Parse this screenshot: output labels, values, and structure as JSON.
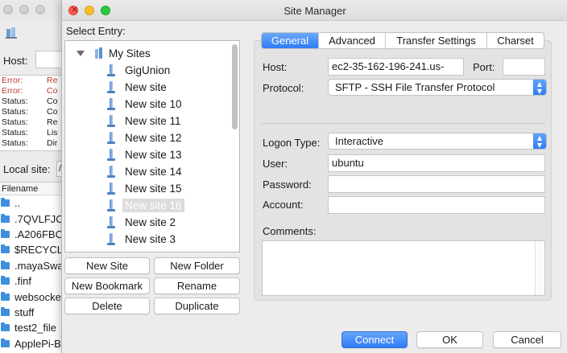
{
  "background_window": {
    "host_label": "Host:",
    "log": [
      {
        "kind": "Error:",
        "text": "Re",
        "is_error": true
      },
      {
        "kind": "Error:",
        "text": "Co",
        "is_error": true
      },
      {
        "kind": "Status:",
        "text": "Co",
        "is_error": false
      },
      {
        "kind": "Status:",
        "text": "Co",
        "is_error": false
      },
      {
        "kind": "Status:",
        "text": "Re",
        "is_error": false
      },
      {
        "kind": "Status:",
        "text": "Lis",
        "is_error": false
      },
      {
        "kind": "Status:",
        "text": "Dir",
        "is_error": false
      }
    ],
    "local_site_label": "Local site:",
    "local_site_value": "/",
    "filename_header": "Filename",
    "files": [
      "..",
      ".7QVLFJC",
      ".A206FBC",
      "$RECYCL",
      ".mayaSwa",
      ".finf",
      "websocke",
      "stuff",
      "test2_file",
      "ApplePi-B"
    ]
  },
  "dialog": {
    "title": "Site Manager",
    "select_entry_label": "Select Entry:",
    "tree": {
      "root": "My Sites",
      "items": [
        {
          "label": "GigUnion",
          "selected": false
        },
        {
          "label": "New site",
          "selected": false
        },
        {
          "label": "New site 10",
          "selected": false
        },
        {
          "label": "New site 11",
          "selected": false
        },
        {
          "label": "New site 12",
          "selected": false
        },
        {
          "label": "New site 13",
          "selected": false
        },
        {
          "label": "New site 14",
          "selected": false
        },
        {
          "label": "New site 15",
          "selected": false
        },
        {
          "label": "New site 16",
          "selected": true
        },
        {
          "label": "New site 2",
          "selected": false
        },
        {
          "label": "New site 3",
          "selected": false
        }
      ]
    },
    "buttons": {
      "new_site": "New Site",
      "new_folder": "New Folder",
      "new_bookmark": "New Bookmark",
      "rename": "Rename",
      "delete": "Delete",
      "duplicate": "Duplicate",
      "connect": "Connect",
      "ok": "OK",
      "cancel": "Cancel"
    },
    "tabs": [
      {
        "label": "General",
        "active": true
      },
      {
        "label": "Advanced",
        "active": false
      },
      {
        "label": "Transfer Settings",
        "active": false
      },
      {
        "label": "Charset",
        "active": false
      }
    ],
    "general": {
      "host_label": "Host:",
      "host_value": "ec2-35-162-196-241.us-",
      "port_label": "Port:",
      "port_value": "",
      "protocol_label": "Protocol:",
      "protocol_value": "SFTP - SSH File Transfer Protocol",
      "logon_type_label": "Logon Type:",
      "logon_type_value": "Interactive",
      "user_label": "User:",
      "user_value": "ubuntu",
      "password_label": "Password:",
      "password_value": "",
      "account_label": "Account:",
      "account_value": "",
      "comments_label": "Comments:",
      "comments_value": ""
    },
    "colors": {
      "accent": "#2f7cf6",
      "error_text": "#c0392b",
      "selection_bg": "#dcdcdc"
    }
  }
}
